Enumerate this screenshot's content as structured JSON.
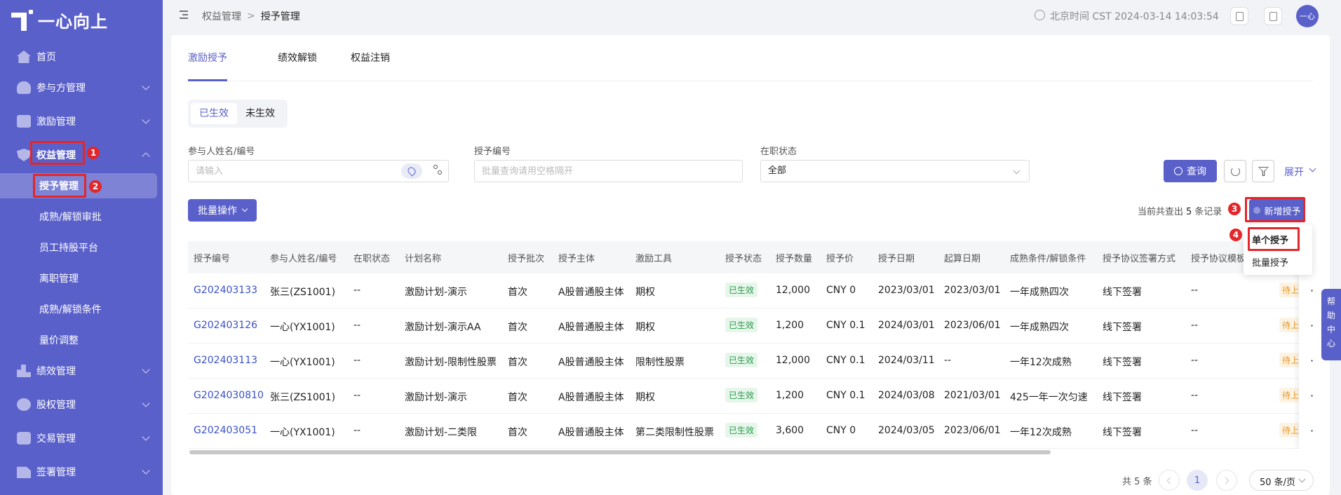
{
  "app": {
    "logo_text": "一心向上"
  },
  "sidebar": {
    "items": [
      {
        "label": "首页"
      },
      {
        "label": "参与方管理"
      },
      {
        "label": "激励管理"
      },
      {
        "label": "权益管理"
      },
      {
        "label": "绩效管理"
      },
      {
        "label": "股权管理"
      },
      {
        "label": "交易管理"
      },
      {
        "label": "签署管理"
      }
    ],
    "sub_items": [
      {
        "label": "授予管理"
      },
      {
        "label": "成熟/解锁审批"
      },
      {
        "label": "员工持股平台"
      },
      {
        "label": "离职管理"
      },
      {
        "label": "成熟/解锁条件"
      },
      {
        "label": "量价调整"
      }
    ]
  },
  "header": {
    "breadcrumb": [
      "权益管理",
      "授予管理"
    ],
    "breadcrumb_sep": ">",
    "time": "北京时间 CST 2024-03-14 14:03:54",
    "avatar": "一心"
  },
  "annotations": [
    "1",
    "2",
    "3",
    "4"
  ],
  "tabs": [
    {
      "label": "激励授予"
    },
    {
      "label": "绩效解锁"
    },
    {
      "label": "权益注销"
    }
  ],
  "segment": [
    {
      "label": "已生效"
    },
    {
      "label": "未生效"
    }
  ],
  "filters": {
    "name": {
      "label": "参与人姓名/编号",
      "placeholder": "请输入"
    },
    "grant_no": {
      "label": "授予编号",
      "placeholder": "批量查询请用空格隔开"
    },
    "status": {
      "label": "在职状态",
      "value": "全部"
    },
    "search_label": "查询",
    "expand_label": "展开"
  },
  "toolbar": {
    "batch_label": "批量操作",
    "count_prefix": "当前共查出",
    "count": "5",
    "count_suffix": "条记录",
    "add_label": "新增授予",
    "dropdown": [
      "单个授予",
      "批量授予"
    ]
  },
  "table": {
    "columns": [
      "授予编号",
      "参与人姓名/编号",
      "在职状态",
      "计划名称",
      "授予批次",
      "授予主体",
      "激励工具",
      "授予状态",
      "授予数量",
      "授予价",
      "授予日期",
      "起算日期",
      "成熟条件/解锁条件",
      "授予协议签署方式",
      "授予协议模板"
    ],
    "rows": [
      [
        "G202403133",
        "张三(ZS1001)",
        "--",
        "激励计划-演示",
        "首次",
        "A股普通股主体",
        "期权",
        "已生效",
        "12,000",
        "CNY  0",
        "2023/03/01",
        "2023/03/01",
        "一年成熟四次",
        "线下签署",
        "--",
        "待上传"
      ],
      [
        "G202403126",
        "一心(YX1001)",
        "--",
        "激励计划-演示AA",
        "首次",
        "A股普通股主体",
        "期权",
        "已生效",
        "1,200",
        "CNY  0.1",
        "2024/03/01",
        "2023/06/01",
        "一年成熟四次",
        "线下签署",
        "--",
        "待上传"
      ],
      [
        "G202403113",
        "一心(YX1001)",
        "--",
        "激励计划-限制性股票",
        "首次",
        "A股普通股主体",
        "限制性股票",
        "已生效",
        "12,000",
        "CNY  0.1",
        "2024/03/11",
        "--",
        "一年12次成熟",
        "线下签署",
        "--",
        "待上传"
      ],
      [
        "G2024030810",
        "张三(ZS1001)",
        "--",
        "激励计划-演示",
        "首次",
        "A股普通股主体",
        "期权",
        "已生效",
        "1,200",
        "CNY  0.1",
        "2024/03/08",
        "2021/03/01",
        "425一年一次匀速",
        "线下签署",
        "--",
        "待上传"
      ],
      [
        "G202403051",
        "一心(YX1001)",
        "--",
        "激励计划-二类限",
        "首次",
        "A股普通股主体",
        "第二类限制性股票",
        "已生效",
        "3,600",
        "CNY  0",
        "2024/03/05",
        "2023/06/01",
        "一年12次成熟",
        "线下签署",
        "--",
        "待上传"
      ]
    ],
    "more_glyph": "···"
  },
  "pagination": {
    "total": "共 5 条",
    "current": "1",
    "page_size": "50 条/页"
  },
  "help": [
    "帮",
    "助",
    "中",
    "心"
  ]
}
